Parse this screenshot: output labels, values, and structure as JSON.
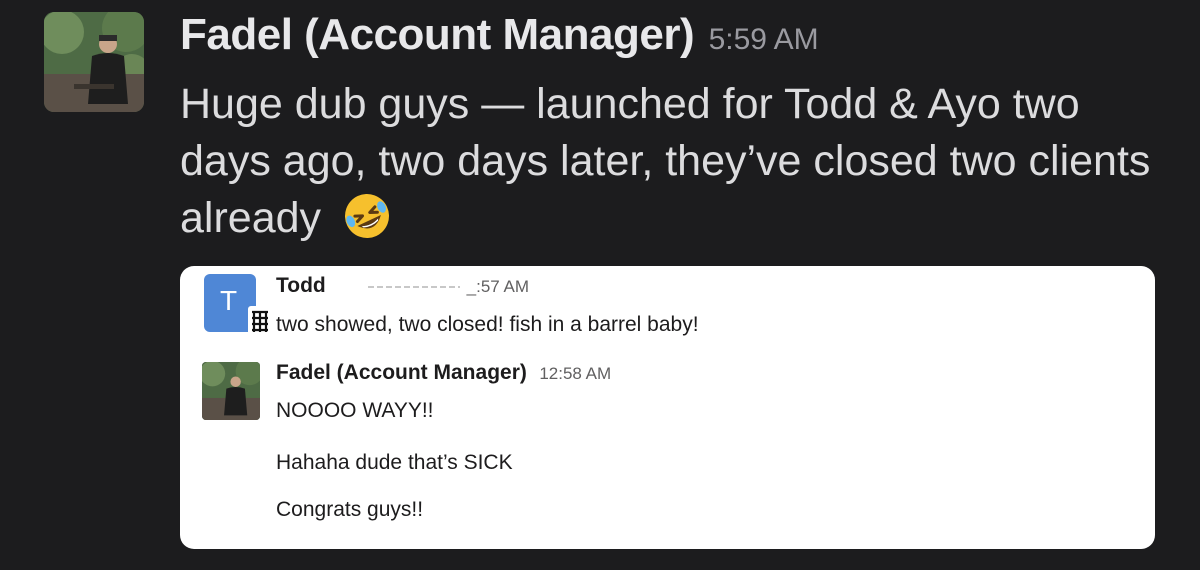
{
  "message": {
    "sender": "Fadel (Account Manager)",
    "time": "5:59 AM",
    "text": "Huge dub guys — launched for Todd & Ayo two days ago, two days later, they’ve closed two clients already",
    "emoji_icon": "rolling-on-floor-laughing-emoji"
  },
  "quote": {
    "todd": {
      "avatar_letter": "T",
      "name": "Todd",
      "time": "_:57 AM",
      "text": "two showed, two closed! fish in a barrel baby!"
    },
    "fadel": {
      "name": "Fadel (Account Manager)",
      "time": "12:58 AM",
      "lines": [
        "NOOOO WAYY!!",
        "Hahaha dude that’s SICK",
        "Congrats guys!!"
      ]
    }
  },
  "colors": {
    "background": "#1c1c1e",
    "card": "#ffffff",
    "avatar_blue": "#4f87d6"
  }
}
